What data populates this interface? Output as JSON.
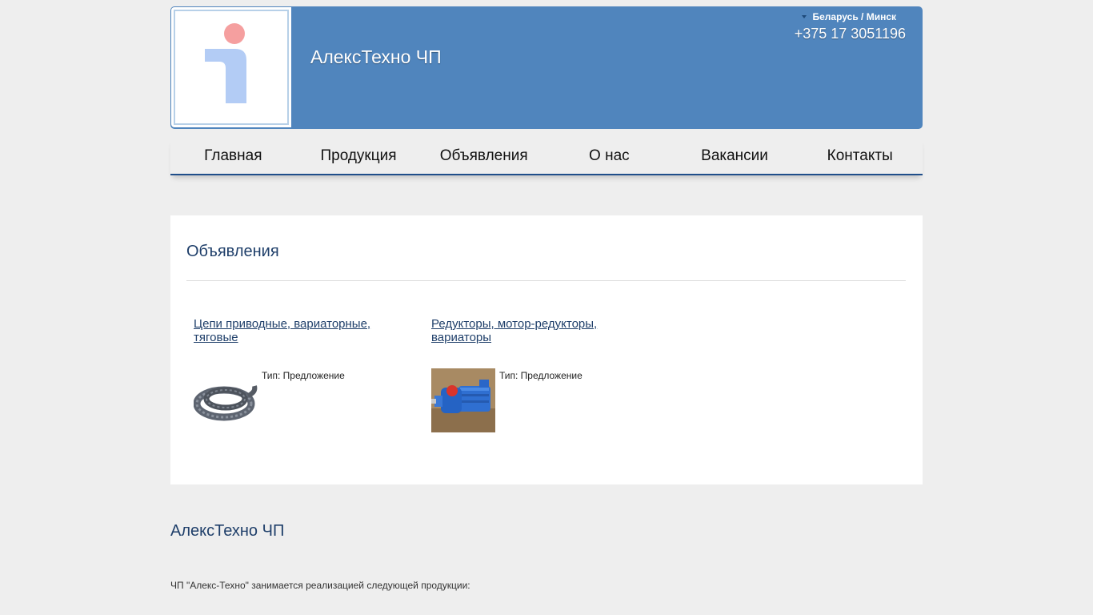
{
  "header": {
    "site_title": "АлексТехно ЧП",
    "region": "Беларусь / Минск",
    "phone": "+375 17 3051196",
    "logo_icon": "info-i-logo"
  },
  "nav": {
    "items": [
      {
        "label": "Главная"
      },
      {
        "label": "Продукция"
      },
      {
        "label": "Объявления"
      },
      {
        "label": "О нас"
      },
      {
        "label": "Вакансии"
      },
      {
        "label": "Контакты"
      }
    ]
  },
  "main": {
    "title": "Объявления",
    "ads": [
      {
        "title_line1": "Цепи приводные, вариаторные,",
        "title_line2": "тяговые",
        "type": "Тип: Предложение"
      },
      {
        "title_line1": "Редукторы, мотор-редукторы,",
        "title_line2": "вариаторы",
        "type": "Тип: Предложение"
      }
    ]
  },
  "about": {
    "title": "АлексТехно ЧП",
    "text": "ЧП \"Алекс-Техно\" занимается реализацией следующей продукции:"
  },
  "colors": {
    "header_bg": "#5085bd",
    "nav_underline": "#1f4e8a",
    "heading": "#1f3f6a",
    "page_bg": "#eeeeee"
  }
}
